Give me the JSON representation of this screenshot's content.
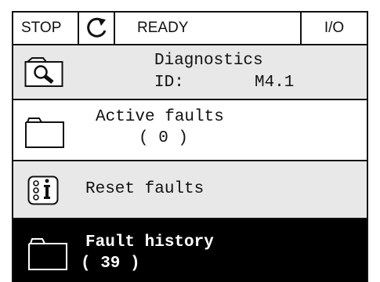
{
  "status_bar": {
    "state": "STOP",
    "mode": "READY",
    "control_place": "I/O",
    "icon": "rotation-direction-icon"
  },
  "header": {
    "title": "Diagnostics",
    "id_label": "ID:",
    "id_value": "M4.1",
    "icon": "magnifier-icon"
  },
  "menu": {
    "items": [
      {
        "label": "Active faults",
        "value": "( 0 )",
        "icon": "folder-icon",
        "selected": false
      },
      {
        "label": "Reset faults",
        "value": "",
        "icon": "reset-icon",
        "selected": false
      },
      {
        "label": "Fault history",
        "value": "( 39 )",
        "icon": "folder-icon",
        "selected": true
      }
    ]
  },
  "colors": {
    "header_bg": "#e8e8e8",
    "selected_bg": "#000000",
    "selected_text": "#ffffff",
    "border": "#111111"
  }
}
